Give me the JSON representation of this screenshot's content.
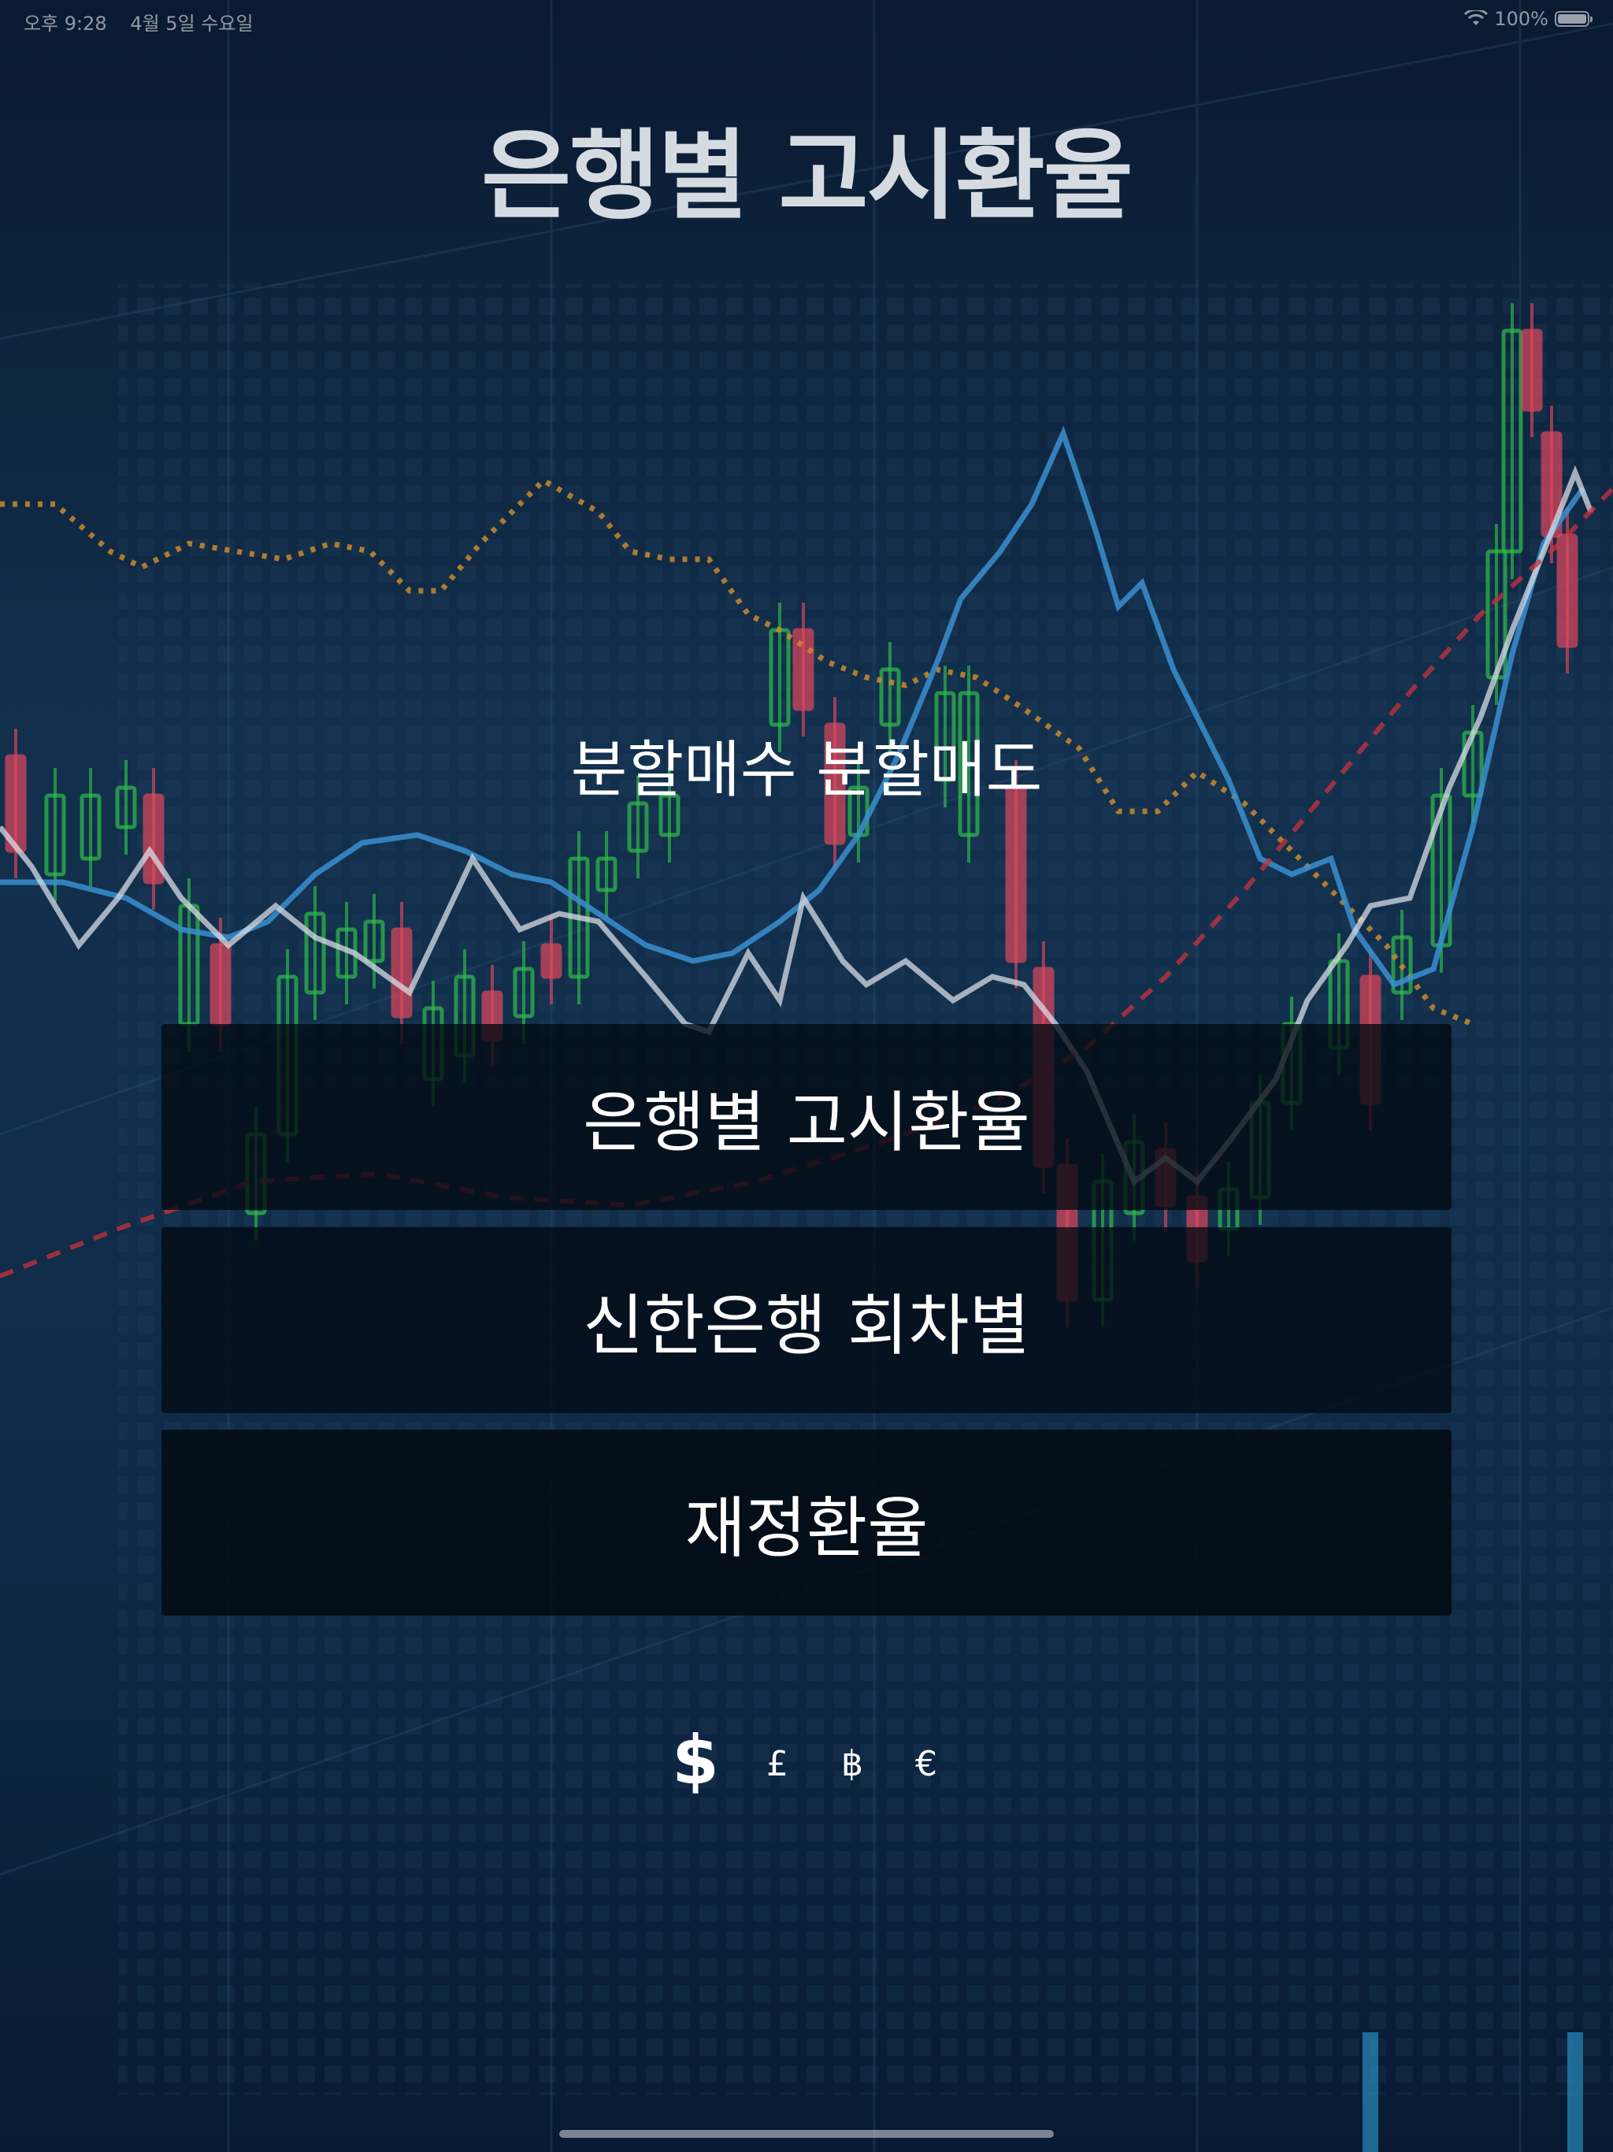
{
  "status_bar": {
    "time": "오후 9:28",
    "date": "4월 5일 수요일",
    "battery": "100%"
  },
  "title": "은행별 고시환율",
  "subtitle": "분할매수 분할매도",
  "menu": [
    {
      "label": "은행별 고시환율"
    },
    {
      "label": "신한은행 회차별"
    },
    {
      "label": "재정환율"
    }
  ],
  "currencies": [
    {
      "symbol": "$",
      "selected": true
    },
    {
      "symbol": "£",
      "selected": false
    },
    {
      "symbol": "฿",
      "selected": false
    },
    {
      "symbol": "€",
      "selected": false
    }
  ],
  "colors": {
    "background": "#0b1b33",
    "candle_up": "#2fbf4a",
    "candle_down": "#e0485e",
    "trend_orange": "#c98a2a",
    "trend_blue": "#3a8fd0",
    "trend_white": "#d8dce4",
    "trend_red": "#c8323c"
  },
  "icons": {
    "wifi": "wifi-icon",
    "battery": "battery-icon",
    "background": "stock-chart-background"
  }
}
